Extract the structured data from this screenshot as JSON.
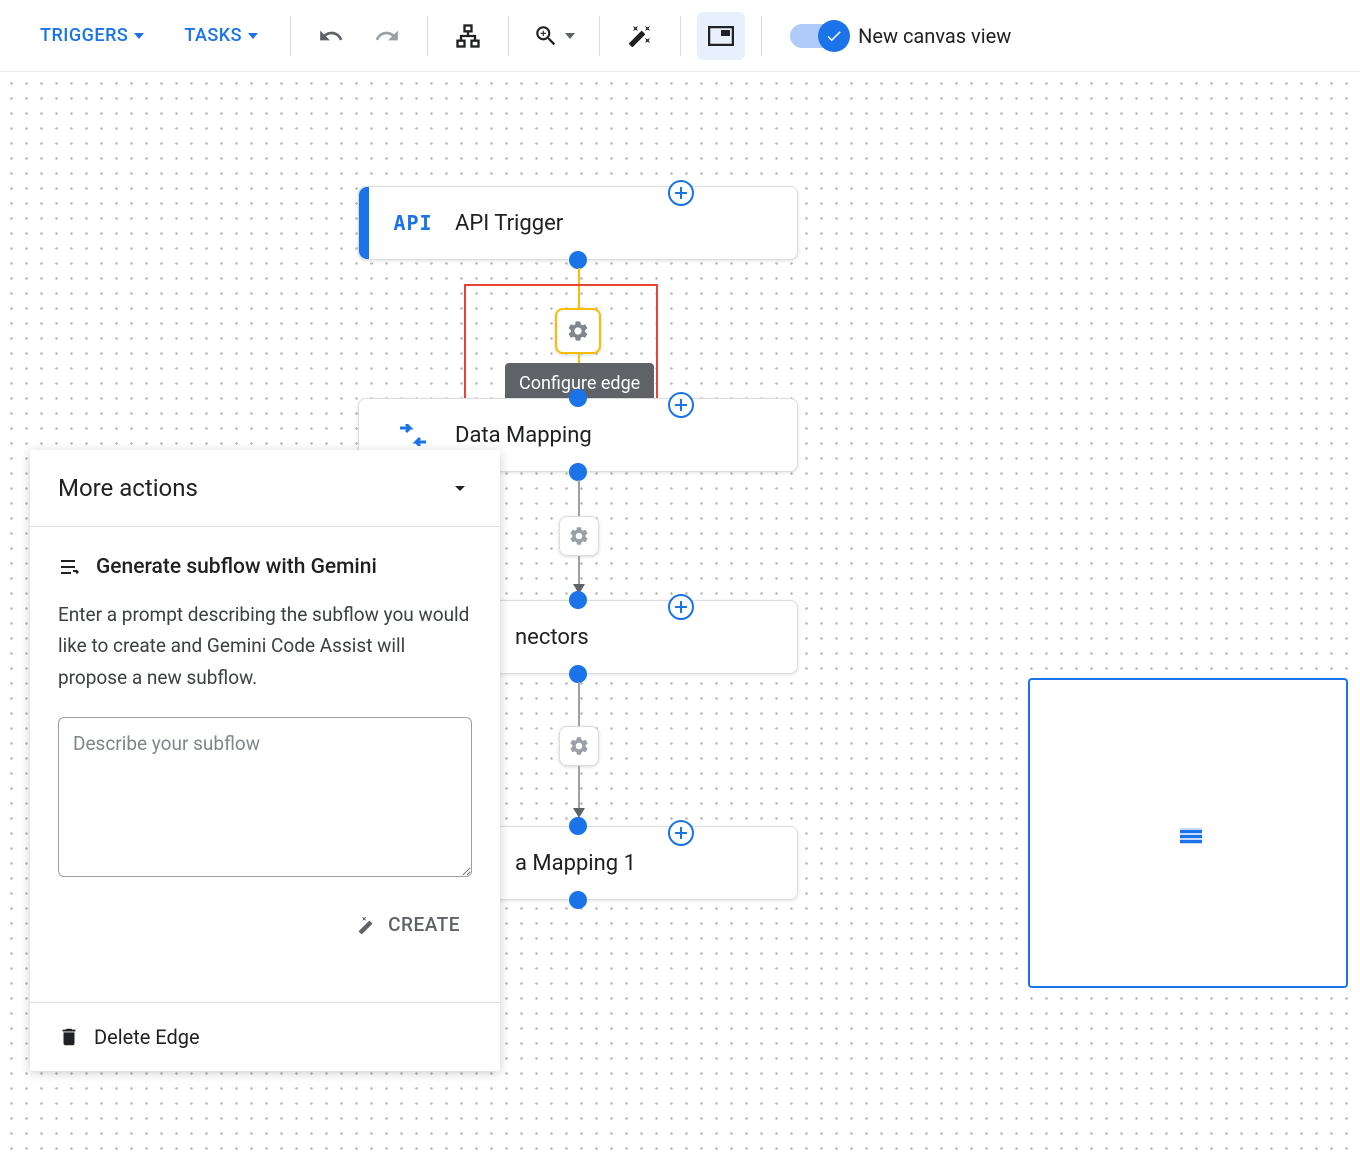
{
  "toolbar": {
    "triggers_label": "TRIGGERS",
    "tasks_label": "TASKS",
    "canvas_toggle_label": "New canvas view"
  },
  "nodes": {
    "api_trigger": {
      "label": "API Trigger",
      "icon_text": "API"
    },
    "data_mapping": {
      "label": "Data Mapping"
    },
    "connectors": {
      "label": "nectors"
    },
    "data_mapping_1": {
      "label": "a Mapping 1"
    }
  },
  "tooltip": {
    "configure_edge": "Configure edge"
  },
  "side_panel": {
    "title": "More actions",
    "generate_heading": "Generate subflow with Gemini",
    "generate_desc": "Enter a prompt describing the subflow you would like to create and Gemini Code Assist will propose a new subflow.",
    "textarea_placeholder": "Describe your subflow",
    "create_label": "CREATE",
    "delete_label": "Delete Edge"
  }
}
